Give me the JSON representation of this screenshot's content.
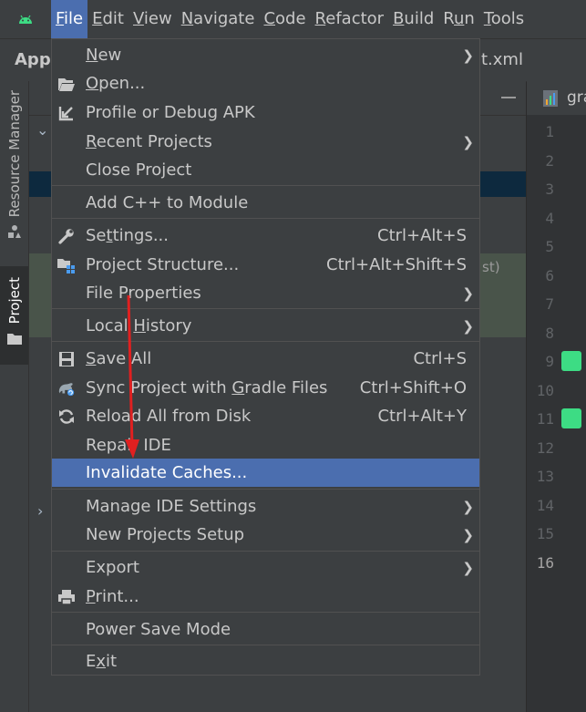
{
  "menubar": {
    "items": [
      {
        "label": "File",
        "accel": "F",
        "rest": "ile"
      },
      {
        "label": "Edit",
        "accel": "E",
        "rest": "dit"
      },
      {
        "label": "View",
        "accel": "V",
        "rest": "iew"
      },
      {
        "label": "Navigate",
        "accel": "N",
        "rest": "avigate"
      },
      {
        "label": "Code",
        "accel": "C",
        "rest": "ode"
      },
      {
        "label": "Refactor",
        "accel": "R",
        "rest": "efactor"
      },
      {
        "label": "Build",
        "accel": "B",
        "rest": "uild"
      },
      {
        "label": "Run",
        "accel": "u",
        "pre": "R",
        "rest": "n"
      },
      {
        "label": "Tools",
        "accel": "T",
        "rest": "ools"
      }
    ]
  },
  "navbar": {
    "project": "Appl",
    "file": "t.xml"
  },
  "toolstrip": {
    "resource_manager": "Resource Manager",
    "project": "Project"
  },
  "project_panel": {
    "side_text": "st)"
  },
  "editor": {
    "tab": "gra",
    "line_numbers": [
      "1",
      "2",
      "3",
      "4",
      "5",
      "6",
      "7",
      "8",
      "9",
      "10",
      "11",
      "12",
      "13",
      "14",
      "15",
      "16"
    ],
    "current_line": "16"
  },
  "file_menu": {
    "items": [
      {
        "id": "new",
        "pre": "",
        "accel": "N",
        "post": "ew",
        "shortcut": "",
        "submenu": true,
        "icon": ""
      },
      {
        "id": "open",
        "pre": "",
        "accel": "O",
        "post": "pen...",
        "shortcut": "",
        "submenu": false,
        "icon": "folder-icon"
      },
      {
        "id": "profile",
        "pre": "Profile or Debug APK",
        "accel": "",
        "post": "",
        "shortcut": "",
        "submenu": false,
        "icon": "import-arrow-icon"
      },
      {
        "id": "recent",
        "pre": "",
        "accel": "R",
        "post": "ecent Projects",
        "shortcut": "",
        "submenu": true,
        "icon": ""
      },
      {
        "id": "close",
        "pre": "Close Project",
        "accel": "",
        "post": "",
        "shortcut": "",
        "submenu": false,
        "icon": ""
      },
      {
        "id": "addcpp",
        "pre": "Add C++ to Module",
        "accel": "",
        "post": "",
        "shortcut": "",
        "submenu": false,
        "icon": ""
      },
      {
        "id": "settings",
        "pre": "Se",
        "accel": "t",
        "post": "tings...",
        "shortcut": "Ctrl+Alt+S",
        "submenu": false,
        "icon": "wrench-icon"
      },
      {
        "id": "structure",
        "pre": "Project Structure...",
        "accel": "",
        "post": "",
        "shortcut": "Ctrl+Alt+Shift+S",
        "submenu": false,
        "icon": "project-structure-icon"
      },
      {
        "id": "fileprops",
        "pre": "File Properties",
        "accel": "",
        "post": "",
        "shortcut": "",
        "submenu": true,
        "icon": ""
      },
      {
        "id": "localhist",
        "pre": "Local ",
        "accel": "H",
        "post": "istory",
        "shortcut": "",
        "submenu": true,
        "icon": ""
      },
      {
        "id": "saveall",
        "pre": "",
        "accel": "S",
        "post": "ave All",
        "shortcut": "Ctrl+S",
        "submenu": false,
        "icon": "save-icon"
      },
      {
        "id": "sync",
        "pre": "Sync Project with ",
        "accel": "G",
        "post": "radle Files",
        "shortcut": "Ctrl+Shift+O",
        "submenu": false,
        "icon": "gradle-sync-icon"
      },
      {
        "id": "reload",
        "pre": "Reload All from Disk",
        "accel": "",
        "post": "",
        "shortcut": "Ctrl+Alt+Y",
        "submenu": false,
        "icon": "reload-icon"
      },
      {
        "id": "repair",
        "pre": "Repair IDE",
        "accel": "",
        "post": "",
        "shortcut": "",
        "submenu": false,
        "icon": ""
      },
      {
        "id": "invalidate",
        "pre": "Invalidate Caches...",
        "accel": "",
        "post": "",
        "shortcut": "",
        "submenu": false,
        "icon": ""
      },
      {
        "id": "manageide",
        "pre": "Manage IDE Settings",
        "accel": "",
        "post": "",
        "shortcut": "",
        "submenu": true,
        "icon": ""
      },
      {
        "id": "newsetup",
        "pre": "New Projects Setup",
        "accel": "",
        "post": "",
        "shortcut": "",
        "submenu": true,
        "icon": ""
      },
      {
        "id": "export",
        "pre": "Export",
        "accel": "",
        "post": "",
        "shortcut": "",
        "submenu": true,
        "icon": ""
      },
      {
        "id": "print",
        "pre": "",
        "accel": "P",
        "post": "rint...",
        "shortcut": "",
        "submenu": false,
        "icon": "printer-icon"
      },
      {
        "id": "powersave",
        "pre": "Power Save Mode",
        "accel": "",
        "post": "",
        "shortcut": "",
        "submenu": false,
        "icon": ""
      },
      {
        "id": "exit",
        "pre": "E",
        "accel": "x",
        "post": "it",
        "shortcut": "",
        "submenu": false,
        "icon": ""
      }
    ],
    "highlighted": "invalidate",
    "submenu_glyph": "❯"
  },
  "colors": {
    "menu_bg": "#3c3f41",
    "highlight": "#4b6eaf",
    "annotation_arrow": "#e02020",
    "android_green": "#3ddc84"
  }
}
